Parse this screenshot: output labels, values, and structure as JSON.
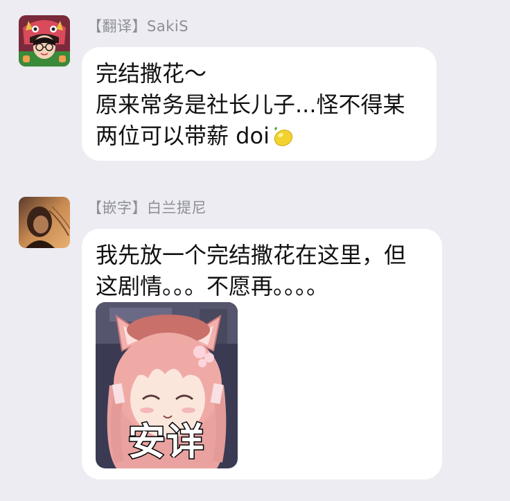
{
  "messages": [
    {
      "sender_label": "【翻译】SakiS",
      "avatar": "avatar-red-dragon-costume",
      "lines": [
        "完结撒花～",
        "原来常务是社长儿子...怪不得某",
        "两位可以带薪 doi"
      ],
      "trailing_emoji": "lemon-icon"
    },
    {
      "sender_label": "【嵌字】白兰提尼",
      "avatar": "avatar-sunset-portrait",
      "lines": [
        "我先放一个完结撒花在这里，但",
        "这剧情。。。不愿再。。。。"
      ],
      "sticker": {
        "caption": "安详",
        "description_icon": "anime-catgirl-sticker"
      }
    }
  ],
  "colors": {
    "background": "#ececf2",
    "bubble": "#ffffff",
    "sender_text": "#8e8e96",
    "message_text": "#111111"
  }
}
